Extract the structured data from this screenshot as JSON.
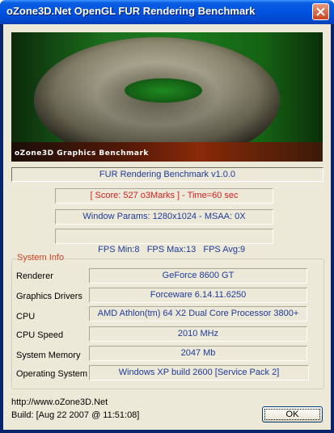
{
  "window": {
    "title": "oZone3D.Net OpenGL FUR Rendering Benchmark"
  },
  "banner": {
    "label": "oZone3D Graphics Benchmark"
  },
  "benchmark": {
    "name": "FUR Rendering Benchmark v1.0.0",
    "score": "[ Score: 527 o3Marks ] - Time=60 sec",
    "window_params": "Window Params: 1280x1024 - MSAA: 0X",
    "fps": "FPS Min:8   FPS Max:13   FPS Avg:9"
  },
  "system_info": {
    "legend": "System Info",
    "rows": [
      {
        "label": "Renderer",
        "value": "GeForce 8600 GT"
      },
      {
        "label": "Graphics Drivers",
        "value": "Forceware 6.14.11.6250"
      },
      {
        "label": "CPU",
        "value": "AMD Athlon(tm) 64 X2 Dual Core Processor 3800+"
      },
      {
        "label": "CPU Speed",
        "value": "2010 MHz"
      },
      {
        "label": "System Memory",
        "value": "2047 Mb"
      },
      {
        "label": "Operating System",
        "value": "Windows XP build 2600 [Service Pack 2]"
      }
    ]
  },
  "footer": {
    "url": "http://www.oZone3D.Net",
    "build": "Build: [Aug 22 2007 @ 11:51:08]",
    "ok_label": "OK"
  },
  "colors": {
    "score_red": "#d81e1e",
    "field_blue": "#1f3a9a",
    "legend_orange": "#d04020"
  }
}
